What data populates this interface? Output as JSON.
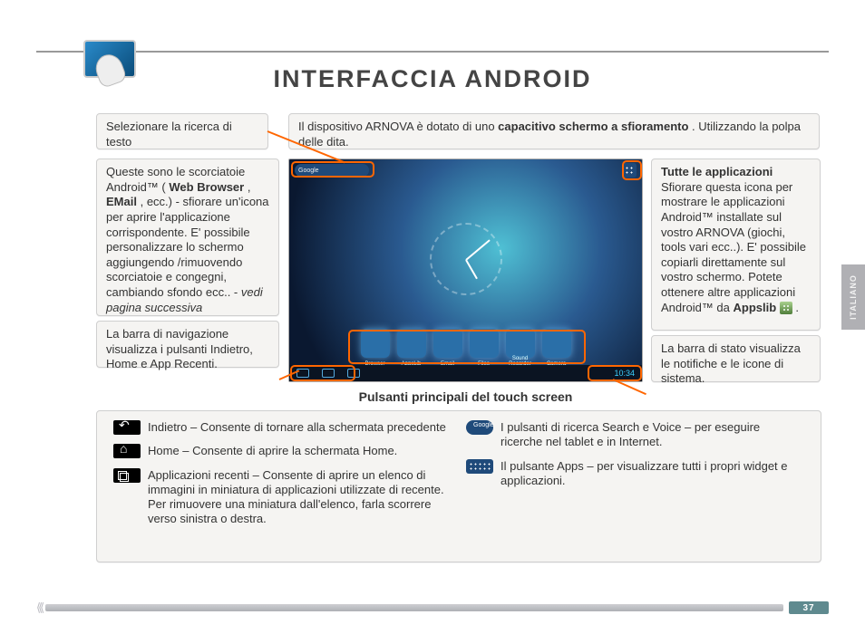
{
  "page": {
    "title": "INTERFACCIA ANDROID",
    "page_number": "37",
    "side_tab": "ITALIANO"
  },
  "boxes": {
    "search": "Selezionare la ricerca di testo",
    "capacitive_pre": "Il dispositivo ARNOVA è dotato di uno ",
    "capacitive_bold": "capacitivo schermo a sfioramento",
    "capacitive_post": ". Utilizzando la polpa delle dita.",
    "shortcuts_pre": "Queste sono le scorciatoie Android™ (",
    "shortcuts_bold1": "Web Browser",
    "shortcuts_mid1": ", ",
    "shortcuts_bold2": "EMail",
    "shortcuts_post": ", ecc.) - sfiorare un'icona per aprire l'applicazione corrispondente. E' possibile personalizzare lo schermo aggiungendo /rimuovendo scorciatoie e congegni, cambiando sfondo ecc.. - ",
    "shortcuts_em": "vedi pagina successiva",
    "navbar": "La barra di navigazione visualizza i pulsanti Indietro, Home e App Recenti.",
    "allapps_title": "Tutte le applicazioni",
    "allapps_body_a": "Sfiorare questa icona per mostrare le applicazioni Android™ installate sul vostro ARNOVA (giochi, tools vari ecc..). E' possibile copiarli direttamente sul vostro schermo. Potete ottenere altre applicazioni Android™ da ",
    "allapps_bold": "Appslib",
    "allapps_body_b": " .",
    "status": "La barra di stato visualizza le notifiche e le icone di sistema."
  },
  "tablet": {
    "google_label": "Google",
    "time": "10:34",
    "dock": [
      {
        "label": "Browser"
      },
      {
        "label": "AppsLib"
      },
      {
        "label": "Email"
      },
      {
        "label": "Files"
      },
      {
        "label": "Sound Recorder"
      },
      {
        "label": "Camera"
      }
    ]
  },
  "subhead": "Pulsanti principali del touch screen",
  "buttons": {
    "back": "Indietro – Consente di tornare alla schermata precedente",
    "home": "Home – Consente di aprire la schermata Home.",
    "recent": "Applicazioni recenti – Consente di aprire un elenco di immagini in miniatura di applicazioni utilizzate di recente. Per rimuovere una miniatura dall'elenco, farla scorrere verso sinistra o destra.",
    "search": "I pulsanti di ricerca Search e Voice – per eseguire ricerche nel tablet e in Internet.",
    "apps": "Il pulsante Apps – per visualizzare tutti i propri widget e applicazioni."
  }
}
